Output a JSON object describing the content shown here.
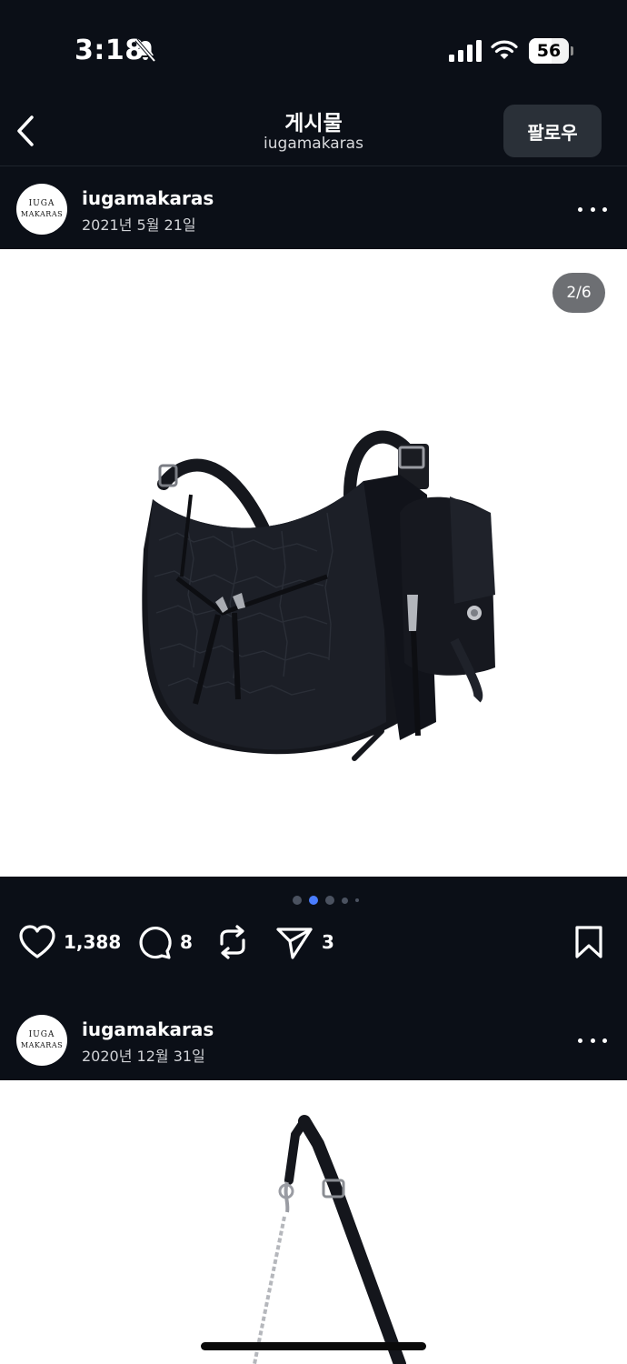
{
  "status_bar": {
    "time": "3:18",
    "battery": "56",
    "battery_level": 0.56,
    "icons": [
      "bell-slash-icon",
      "cellular-signal-icon",
      "wifi-icon",
      "battery-icon"
    ]
  },
  "header": {
    "title": "게시물",
    "subtitle": "iugamakaras",
    "follow_label": "팔로우",
    "back_icon": "chevron-left-icon"
  },
  "posts": [
    {
      "avatar_text": [
        "IUGA",
        "MAKARAS"
      ],
      "username": "iugamakaras",
      "date": "2021년 5월 21일",
      "image_counter": "2/6",
      "image_subject": "black croc-embossed shoulder bag with attached pouch",
      "carousel_active_index": 1,
      "carousel_dots": 5,
      "likes": "1,388",
      "comments": "8",
      "shares": "3",
      "action_icons": [
        "heart-icon",
        "comment-icon",
        "repost-icon",
        "send-icon",
        "bookmark-icon"
      ]
    },
    {
      "avatar_text": [
        "IUGA",
        "MAKARAS"
      ],
      "username": "iugamakaras",
      "date": "2020년 12월 31일",
      "image_subject": "black bag strap with chain"
    }
  ],
  "colors": {
    "background": "#0b0f17",
    "button": "#2a3038",
    "active_dot": "#4a7dff",
    "inactive_dot": "#4b5260",
    "badge": "#6d6f73"
  }
}
